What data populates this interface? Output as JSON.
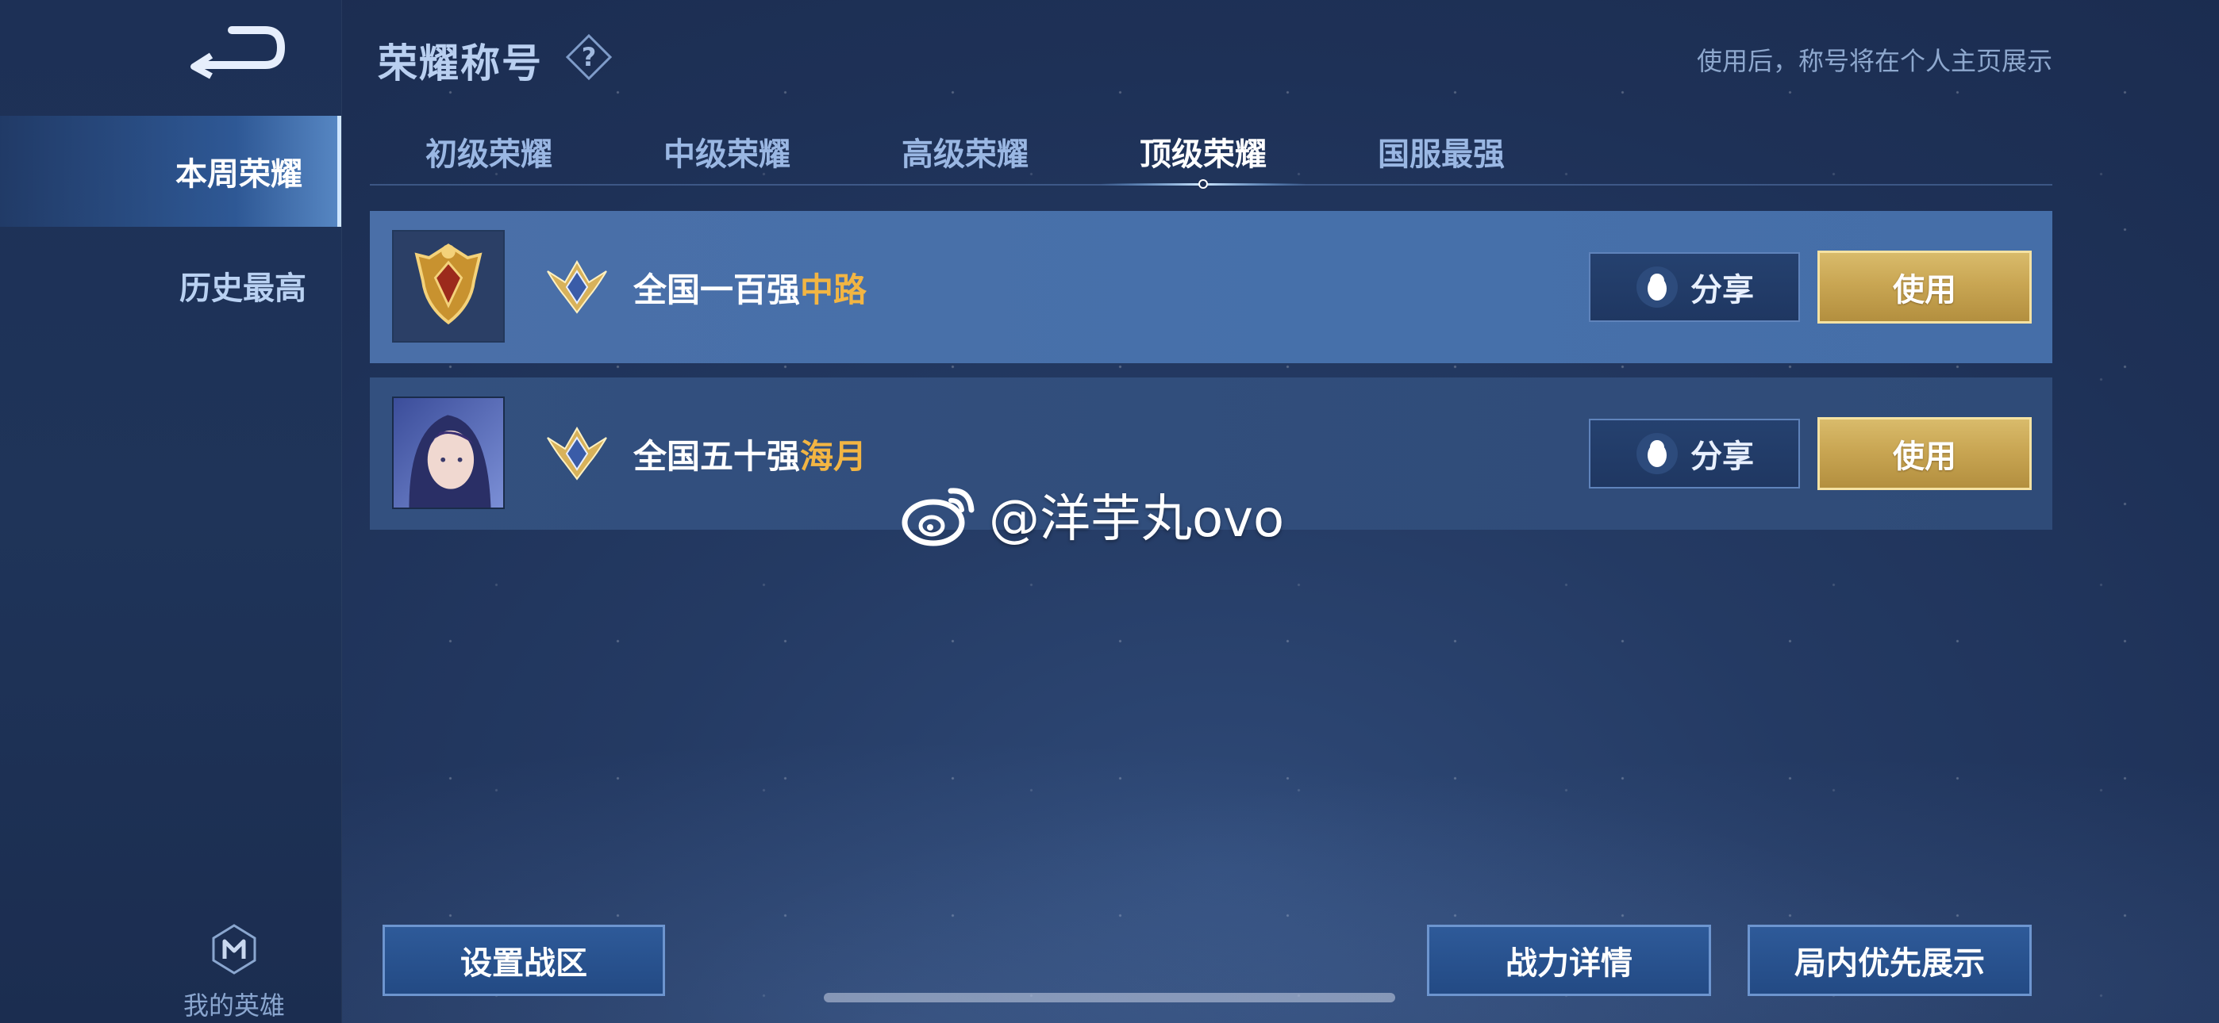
{
  "sidebar": {
    "items": [
      {
        "label": "本周荣耀",
        "active": true
      },
      {
        "label": "历史最高",
        "active": false
      }
    ],
    "my_hero_label": "我的英雄"
  },
  "header": {
    "title": "荣耀称号",
    "hint": "使用后，称号将在个人主页展示"
  },
  "tabs": [
    {
      "label": "初级荣耀",
      "active": false
    },
    {
      "label": "中级荣耀",
      "active": false
    },
    {
      "label": "高级荣耀",
      "active": false
    },
    {
      "label": "顶级荣耀",
      "active": true
    },
    {
      "label": "国服最强",
      "active": false
    }
  ],
  "titles": [
    {
      "prefix": "全国一百强",
      "hero": "中路",
      "avatar": "gold-rank-emblem",
      "share_label": "分享",
      "use_label": "使用"
    },
    {
      "prefix": "全国五十强",
      "hero": "海月",
      "avatar": "hero-portrait-haiyue",
      "share_label": "分享",
      "use_label": "使用"
    }
  ],
  "watermark": "@洋芋丸ovo",
  "bottom": {
    "set_region": "设置战区",
    "power_details": "战力详情",
    "priority_display": "局内优先展示"
  },
  "colors": {
    "accent_gold": "#f2b543",
    "use_button": "#c9a653",
    "panel_highlight": "#4a6fa8"
  }
}
